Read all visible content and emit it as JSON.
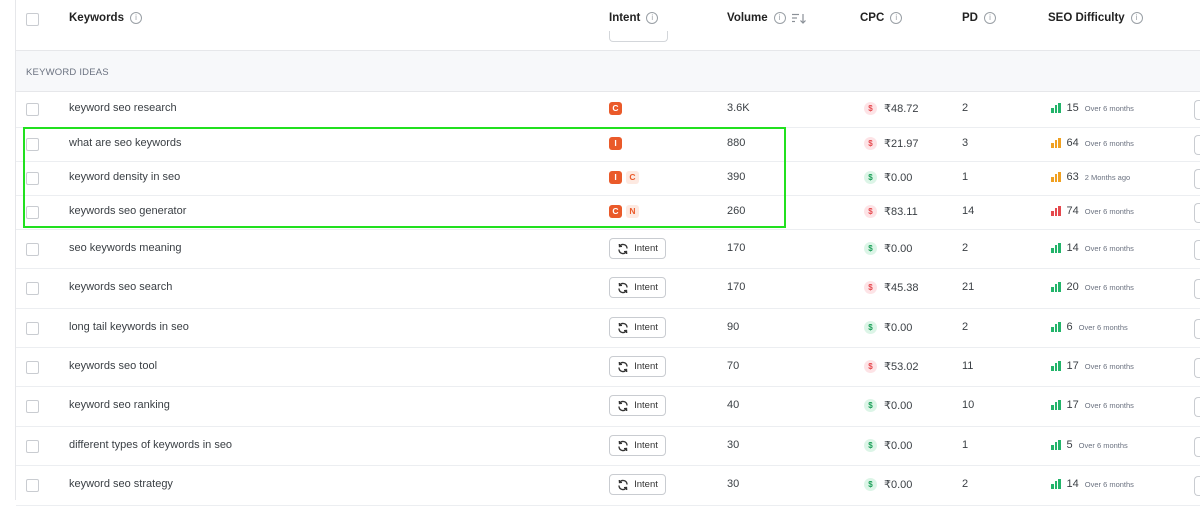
{
  "header": {
    "keywords": "Keywords",
    "intent": "Intent",
    "volume": "Volume",
    "cpc": "CPC",
    "pd": "PD",
    "seo_difficulty": "SEO Difficulty"
  },
  "section_label": "KEYWORD IDEAS",
  "intent_button_label": "Intent",
  "colors": {
    "intent_badge": "#ea5a2a",
    "cpc_red": "#e5484d",
    "cpc_green": "#1a9e57",
    "difficulty_green": "#22b46a",
    "difficulty_orange": "#f0a020",
    "difficulty_red": "#e5484d",
    "highlight": "#21e01f"
  },
  "rows": [
    {
      "keyword": "keyword seo research",
      "badges": [
        {
          "letter": "C",
          "style": "solid"
        }
      ],
      "volume": "3.6K",
      "cpc": "₹48.72",
      "cpc_color": "red",
      "pd": "2",
      "difficulty": "15",
      "difficulty_color": "green",
      "updated": "Over 6 months"
    },
    {
      "keyword": "what are seo keywords",
      "badges": [
        {
          "letter": "I",
          "style": "solid"
        }
      ],
      "volume": "880",
      "cpc": "₹21.97",
      "cpc_color": "red",
      "pd": "3",
      "difficulty": "64",
      "difficulty_color": "orange",
      "updated": "Over 6 months"
    },
    {
      "keyword": "keyword density in seo",
      "badges": [
        {
          "letter": "I",
          "style": "solid"
        },
        {
          "letter": "C",
          "style": "light"
        }
      ],
      "volume": "390",
      "cpc": "₹0.00",
      "cpc_color": "green",
      "pd": "1",
      "difficulty": "63",
      "difficulty_color": "orange",
      "updated": "2 Months ago"
    },
    {
      "keyword": "keywords seo generator",
      "badges": [
        {
          "letter": "C",
          "style": "solid"
        },
        {
          "letter": "N",
          "style": "light"
        }
      ],
      "volume": "260",
      "cpc": "₹83.11",
      "cpc_color": "red",
      "pd": "14",
      "difficulty": "74",
      "difficulty_color": "red",
      "updated": "Over 6 months"
    },
    {
      "keyword": "seo keywords meaning",
      "badges": [],
      "volume": "170",
      "cpc": "₹0.00",
      "cpc_color": "green",
      "pd": "2",
      "difficulty": "14",
      "difficulty_color": "green",
      "updated": "Over 6 months"
    },
    {
      "keyword": "keywords seo search",
      "badges": [],
      "volume": "170",
      "cpc": "₹45.38",
      "cpc_color": "red",
      "pd": "21",
      "difficulty": "20",
      "difficulty_color": "green",
      "updated": "Over 6 months"
    },
    {
      "keyword": "long tail keywords in seo",
      "badges": [],
      "volume": "90",
      "cpc": "₹0.00",
      "cpc_color": "green",
      "pd": "2",
      "difficulty": "6",
      "difficulty_color": "green",
      "updated": "Over 6 months"
    },
    {
      "keyword": "keywords seo tool",
      "badges": [],
      "volume": "70",
      "cpc": "₹53.02",
      "cpc_color": "red",
      "pd": "11",
      "difficulty": "17",
      "difficulty_color": "green",
      "updated": "Over 6 months"
    },
    {
      "keyword": "keyword seo ranking",
      "badges": [],
      "volume": "40",
      "cpc": "₹0.00",
      "cpc_color": "green",
      "pd": "10",
      "difficulty": "17",
      "difficulty_color": "green",
      "updated": "Over 6 months"
    },
    {
      "keyword": "different types of keywords in seo",
      "badges": [],
      "volume": "30",
      "cpc": "₹0.00",
      "cpc_color": "green",
      "pd": "1",
      "difficulty": "5",
      "difficulty_color": "green",
      "updated": "Over 6 months"
    },
    {
      "keyword": "keyword seo strategy",
      "badges": [],
      "volume": "30",
      "cpc": "₹0.00",
      "cpc_color": "green",
      "pd": "2",
      "difficulty": "14",
      "difficulty_color": "green",
      "updated": "Over 6 months"
    }
  ]
}
